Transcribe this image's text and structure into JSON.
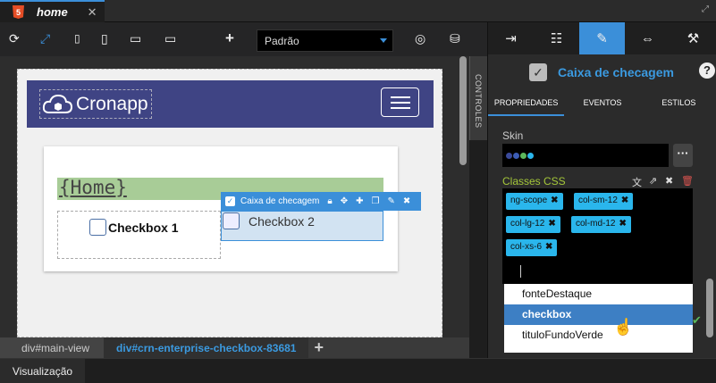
{
  "tab": {
    "badge": "5",
    "title": "home",
    "close": "✕"
  },
  "toolbar": {
    "icons": [
      "refresh-icon",
      "fit-screen-icon",
      "phone-icon",
      "tablet-icon",
      "desktop-icon",
      "monitor-icon",
      "add-icon",
      "eye-off-icon",
      "database-icon"
    ],
    "skin_value": "Padrão"
  },
  "canvas": {
    "logo_text": "Cronapp",
    "title": "{Home}",
    "checkbox1_label": "Checkbox 1",
    "checkbox2_label": "Checkbox 2",
    "selection_label": "Caixa de checagem"
  },
  "side_tab": {
    "label": "CONTROLES"
  },
  "breadcrumb": {
    "items": [
      "div#main-view",
      "div#crn-enterprise-checkbox-83681"
    ],
    "add": "+"
  },
  "statusbar": {
    "visualizacao": "Visualização"
  },
  "panel": {
    "component_title": "Caixa de checagem",
    "help": "?",
    "sub_tabs": [
      "PROPRIEDADES",
      "EVENTOS",
      "ESTILOS"
    ],
    "skin_label": "Skin",
    "skin_more": "···",
    "skin_dots": [
      "#3a4a9a",
      "#3b5cb5",
      "#5cb85c",
      "#2ab6ec"
    ],
    "classes_label": "Classes CSS",
    "classes": [
      "ng-scope",
      "col-sm-12",
      "col-lg-12",
      "col-md-12",
      "col-xs-6"
    ],
    "dropdown": [
      "fonteDestaque",
      "checkbox",
      "tituloFundoVerde"
    ]
  },
  "colors": {
    "accent": "#3b8fd9",
    "navbar": "#3f4484",
    "green": "#a8cc97",
    "chip": "#2ab6ec"
  }
}
